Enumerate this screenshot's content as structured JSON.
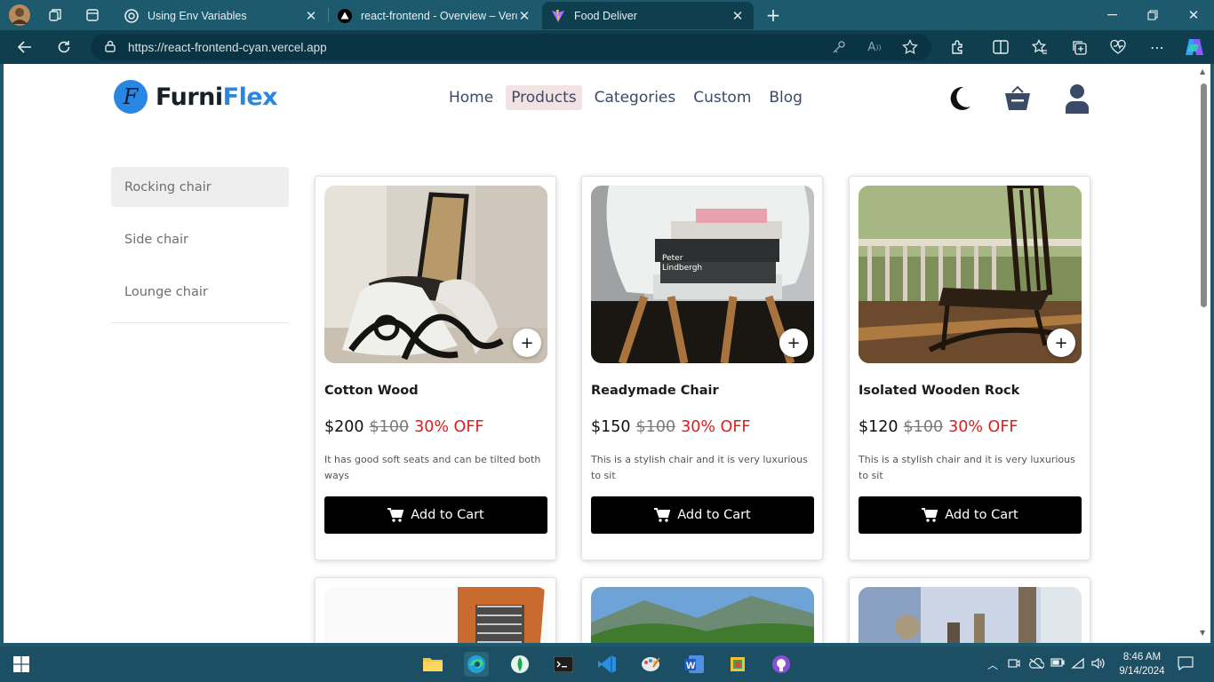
{
  "browser": {
    "tabs": [
      {
        "title": "Using Env Variables",
        "favicon": "openai-icon"
      },
      {
        "title": "react-frontend - Overview – Verce",
        "favicon": "vercel-icon"
      },
      {
        "title": "Food Deliver",
        "favicon": "vite-icon",
        "active": true
      }
    ],
    "url": "https://react-frontend-cyan.vercel.app"
  },
  "site": {
    "logo_part1": "Furni",
    "logo_part2": "Flex",
    "logo_badge": "F",
    "brand_color": "#2a86e3",
    "nav": [
      "Home",
      "Products",
      "Categories",
      "Custom",
      "Blog"
    ],
    "active_nav": "Products"
  },
  "sidebar": {
    "categories": [
      "Rocking chair",
      "Side chair",
      "Lounge chair"
    ],
    "selected": "Rocking chair"
  },
  "products": [
    {
      "name": "Cotton Wood",
      "price": "$200",
      "old_price": "$100",
      "discount": "30% OFF",
      "description": "It has good soft seats and can be tilted both ways",
      "button": "Add to Cart"
    },
    {
      "name": "Readymade Chair",
      "price": "$150",
      "old_price": "$100",
      "discount": "30% OFF",
      "description": "This is a stylish chair and it is very luxurious to sit",
      "button": "Add to Cart"
    },
    {
      "name": "Isolated Wooden Rock",
      "price": "$120",
      "old_price": "$100",
      "discount": "30% OFF",
      "description": "This is a stylish chair and it is very luxurious to sit",
      "button": "Add to Cart"
    }
  ],
  "taskbar": {
    "time": "8:46 AM",
    "date": "9/14/2024"
  }
}
